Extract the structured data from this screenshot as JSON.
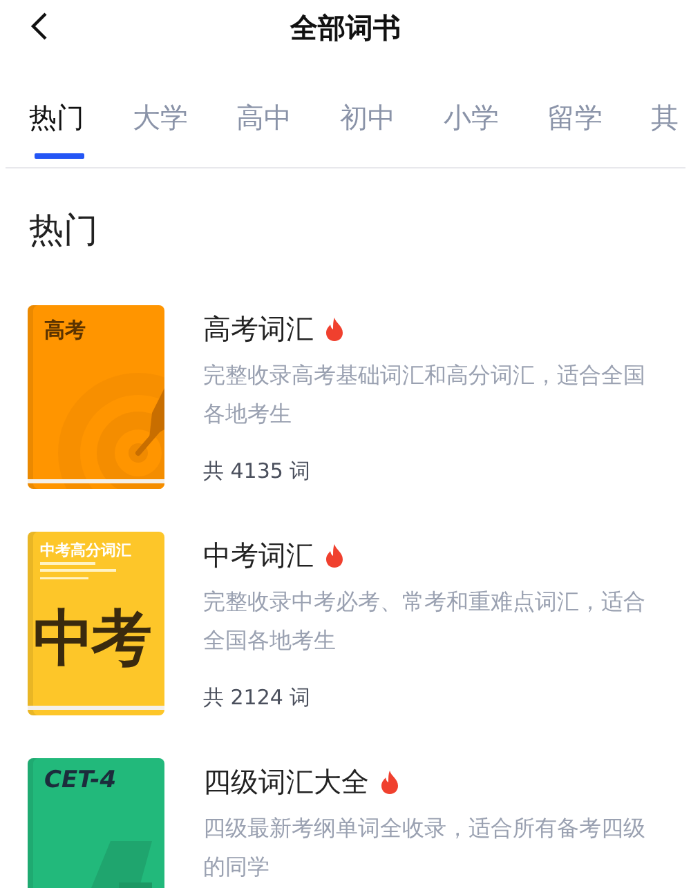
{
  "header": {
    "title": "全部词书"
  },
  "tabs": [
    {
      "label": "热门",
      "selected": true
    },
    {
      "label": "大学",
      "selected": false
    },
    {
      "label": "高中",
      "selected": false
    },
    {
      "label": "初中",
      "selected": false
    },
    {
      "label": "小学",
      "selected": false
    },
    {
      "label": "留学",
      "selected": false
    },
    {
      "label": "其",
      "selected": false
    }
  ],
  "section": {
    "title": "热门"
  },
  "books": [
    {
      "title": "高考词汇",
      "hot": true,
      "description": "完整收录高考基础词汇和高分词汇，适合全国各地考生",
      "count": "共 4135 词",
      "cover": {
        "kind": "target",
        "color": "#ff9500",
        "title": "高考"
      }
    },
    {
      "title": "中考词汇",
      "hot": true,
      "description": "完整收录中考必考、常考和重难点词汇，适合全国各地考生",
      "count": "共 2124 词",
      "cover": {
        "kind": "bigtext",
        "color": "#fdc629",
        "title": "中考高分词汇",
        "big": "中考"
      }
    },
    {
      "title": "四级词汇大全",
      "hot": true,
      "description": "四级最新考纲单词全收录，适合所有备考四级的同学",
      "cover": {
        "kind": "stripe",
        "color": "#22b97b",
        "title": "CET-4"
      }
    }
  ]
}
